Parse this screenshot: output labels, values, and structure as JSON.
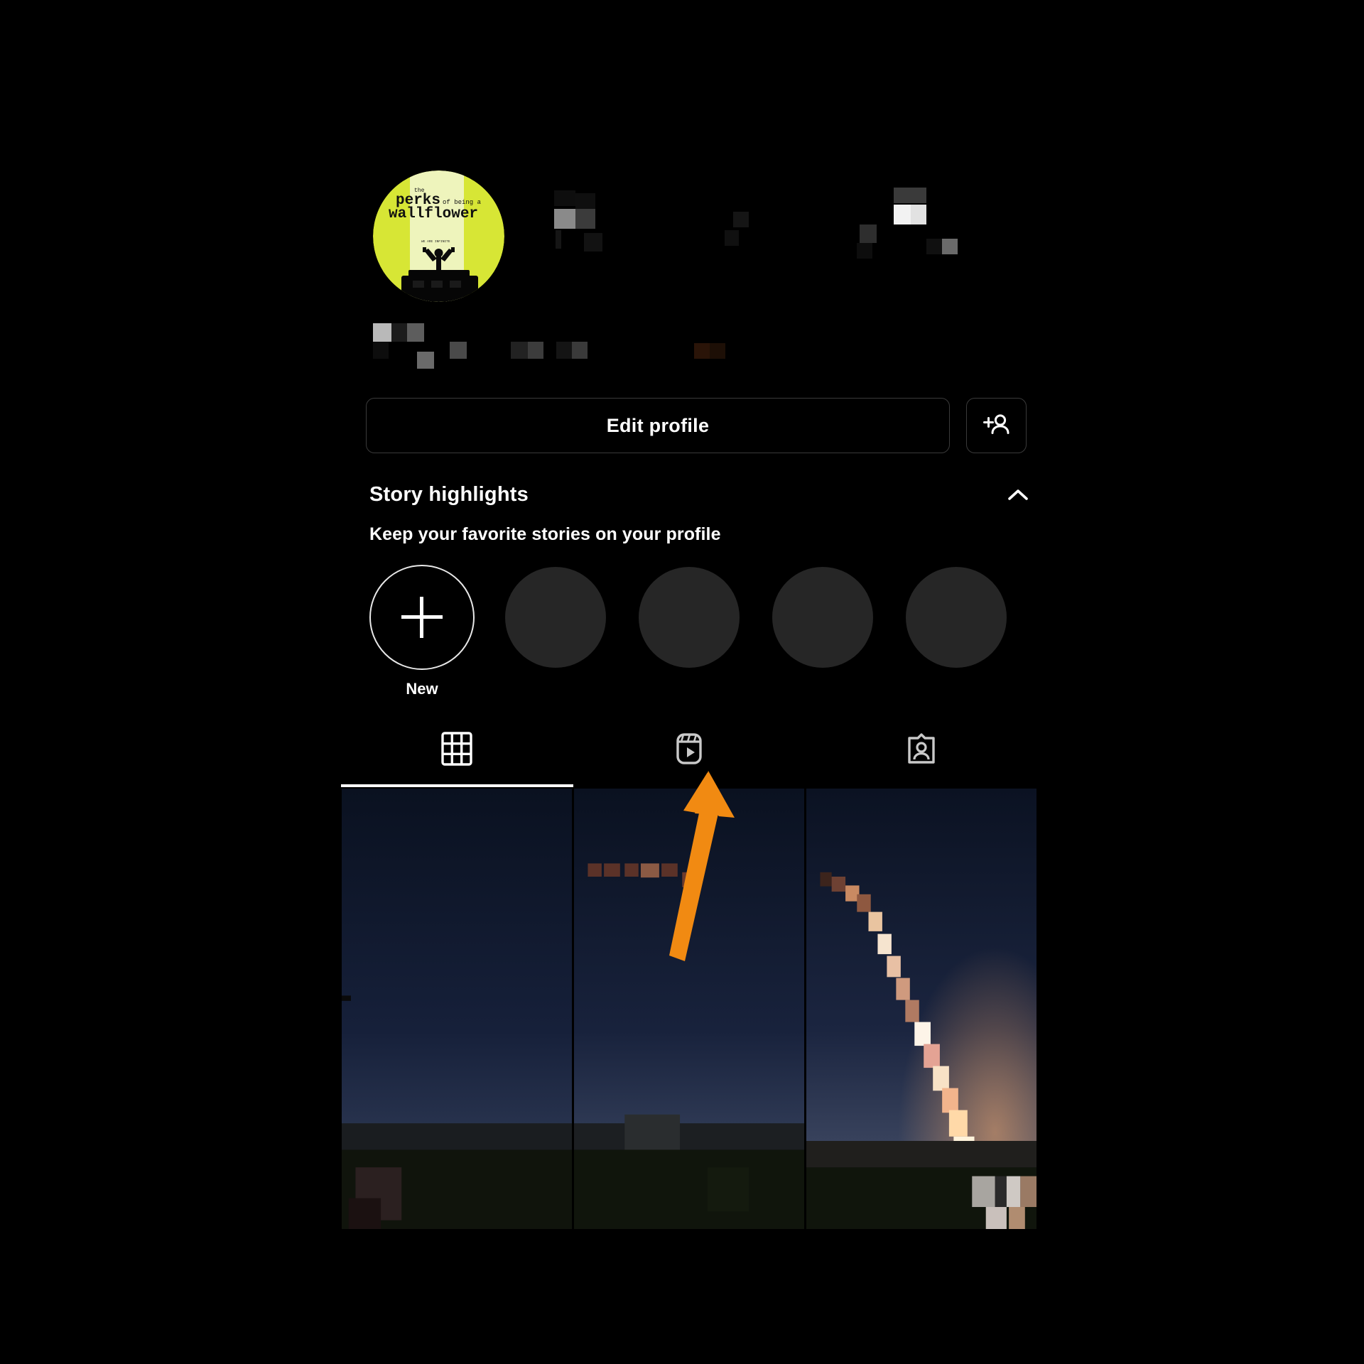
{
  "app": {
    "name": "Instagram",
    "screen": "profile",
    "theme": "dark",
    "background_color": "#000000"
  },
  "profile": {
    "avatar": {
      "icon": "profile-avatar",
      "description": "The Perks of Being a Wallflower movie poster",
      "poster_title_line1": "the",
      "poster_title_line2": "perks of being a",
      "poster_title_line3": "wallflower",
      "poster_background": "#d9e83a",
      "poster_panel": "#eef5b8"
    },
    "username_censored": true,
    "stats_censored": true,
    "bio_censored": true
  },
  "actions": {
    "edit_profile_label": "Edit profile",
    "add_person_icon": "add-person-icon"
  },
  "highlights": {
    "title": "Story highlights",
    "subtitle": "Keep your favorite stories on your profile",
    "collapse_icon": "chevron-up-icon",
    "new_label": "New",
    "new_icon": "plus-icon",
    "placeholder_count": 4,
    "placeholder_color": "#262626"
  },
  "tabs": [
    {
      "id": "posts",
      "icon": "grid-icon",
      "active": true
    },
    {
      "id": "reels",
      "icon": "reels-icon",
      "active": false
    },
    {
      "id": "tagged",
      "icon": "tagged-icon",
      "active": false
    }
  ],
  "grid": {
    "columns": 3,
    "items": [
      {
        "id": "post-1",
        "description": "night sky over dark field"
      },
      {
        "id": "post-2",
        "description": "night sky with faint light streak"
      },
      {
        "id": "post-3",
        "description": "night sky with bright meteor trail"
      }
    ]
  },
  "annotation": {
    "type": "arrow",
    "color": "#f18a12",
    "points_to": "reels-tab",
    "direction": "up"
  }
}
